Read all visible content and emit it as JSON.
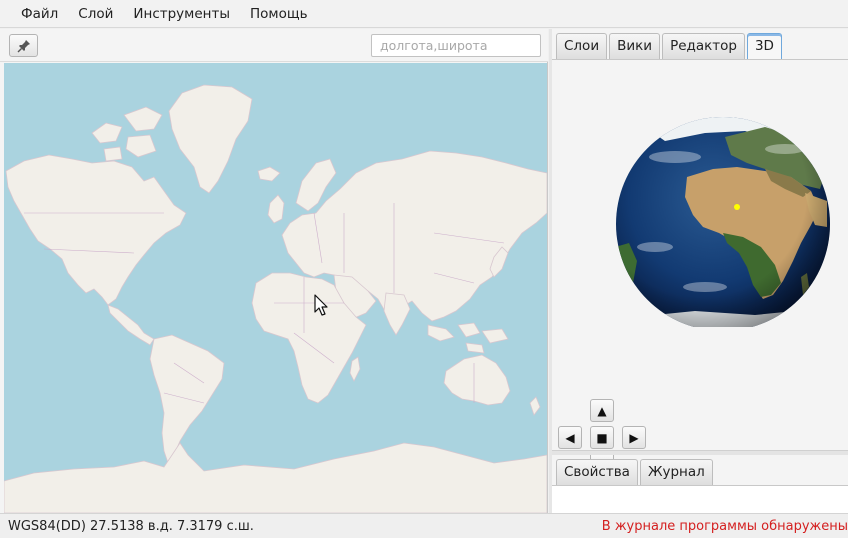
{
  "menu": {
    "items": [
      {
        "label": "Файл"
      },
      {
        "label": "Слой"
      },
      {
        "label": "Инструменты"
      },
      {
        "label": "Помощь"
      }
    ]
  },
  "map_toolbar": {
    "pin_icon": "pin-icon",
    "coord_input": {
      "value": "",
      "placeholder": "долгота,широта"
    }
  },
  "map": {
    "ocean_color": "#aad3df",
    "land_color": "#f2efe9",
    "border_color": "#c9a8c8",
    "cursor_icon": "mouse-pointer-icon"
  },
  "right_tabs": {
    "items": [
      {
        "label": "Слои"
      },
      {
        "label": "Вики"
      },
      {
        "label": "Редактор"
      },
      {
        "label": "3D"
      }
    ],
    "active": "3D"
  },
  "globe": {
    "ocean_color": "#0f2c5c",
    "marker_color": "#ffff00"
  },
  "nav": {
    "up_icon": "arrow-up-icon",
    "left_icon": "arrow-left-icon",
    "stop_icon": "stop-icon",
    "right_icon": "arrow-right-icon",
    "down_icon": "arrow-down-icon"
  },
  "bottom_tabs": {
    "items": [
      {
        "label": "Свойства"
      },
      {
        "label": "Журнал"
      }
    ]
  },
  "status": {
    "coords": "WGS84(DD) 27.5138 в.д. 7.3179 с.ш.",
    "warning": "В журнале программы обнаружены",
    "warning_color": "#d42020"
  }
}
